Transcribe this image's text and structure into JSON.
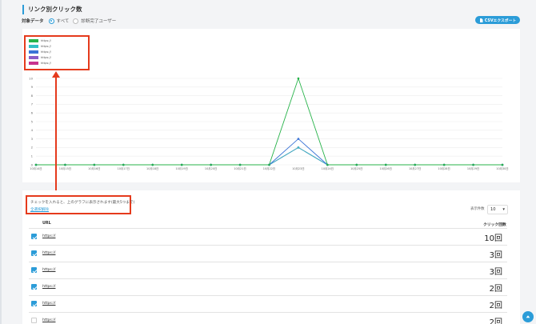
{
  "page": {
    "title": "リンク別クリック数",
    "filter_label": "対象データ",
    "filter_options": [
      {
        "label": "すべて",
        "selected": true
      },
      {
        "label": "診断完了ユーザー",
        "selected": false
      }
    ],
    "export_label": "CSVエクスポート"
  },
  "colors": {
    "accent": "#2b9cd8",
    "annotation": "#e53a1c",
    "green": "#27b34a",
    "teal": "#33c0c4",
    "blue": "#3a73d6",
    "purple": "#8a5cc7",
    "magenta": "#c7338f"
  },
  "chart_data": {
    "type": "line",
    "x": [
      "10月14日",
      "10月15日",
      "10月16日",
      "10月17日",
      "10月18日",
      "10月19日",
      "10月20日",
      "10月21日",
      "10月22日",
      "10月23日",
      "10月24日",
      "10月25日",
      "10月26日",
      "10月27日",
      "10月28日",
      "10月29日",
      "10月30日"
    ],
    "ylim": [
      0,
      10
    ],
    "yticks": [
      0,
      1,
      2,
      3,
      4,
      5,
      6,
      7,
      8,
      9,
      10
    ],
    "grid": true,
    "legend_position": "top-left",
    "series": [
      {
        "name": "https://",
        "color": "#27b34a",
        "values": [
          0,
          0,
          0,
          0,
          0,
          0,
          0,
          0,
          0,
          10,
          0,
          0,
          0,
          0,
          0,
          0,
          0
        ]
      },
      {
        "name": "https://",
        "color": "#33c0c4",
        "values": [
          0,
          0,
          0,
          0,
          0,
          0,
          0,
          0,
          0,
          2,
          0,
          0,
          0,
          0,
          0,
          0,
          0
        ]
      },
      {
        "name": "https://",
        "color": "#3a73d6",
        "values": [
          0,
          0,
          0,
          0,
          0,
          0,
          0,
          0,
          0,
          3,
          0,
          0,
          0,
          0,
          0,
          0,
          0
        ]
      },
      {
        "name": "https://",
        "color": "#8a5cc7",
        "values": [
          0,
          0,
          0,
          0,
          0,
          0,
          0,
          0,
          0,
          2,
          0,
          0,
          0,
          0,
          0,
          0,
          0
        ]
      },
      {
        "name": "https://",
        "color": "#c7338f",
        "values": [
          0,
          0,
          0,
          0,
          0,
          0,
          0,
          0,
          0,
          2,
          0,
          0,
          0,
          0,
          0,
          0,
          0
        ]
      }
    ]
  },
  "list": {
    "hint": "チェックを入れると、上のグラフに表示されます(最大5つまで)",
    "deselect_label": "全選択解除",
    "per_page_label": "表示件数",
    "per_page_value": "10",
    "col_url": "URL",
    "col_clicks": "クリック回数",
    "rows": [
      {
        "url": "https://",
        "clicks": "10回",
        "checked": true
      },
      {
        "url": "https://",
        "clicks": "3回",
        "checked": true
      },
      {
        "url": "https://",
        "clicks": "3回",
        "checked": true
      },
      {
        "url": "https://",
        "clicks": "2回",
        "checked": true
      },
      {
        "url": "https://",
        "clicks": "2回",
        "checked": true
      },
      {
        "url": "https://",
        "clicks": "2回",
        "checked": false
      }
    ]
  }
}
